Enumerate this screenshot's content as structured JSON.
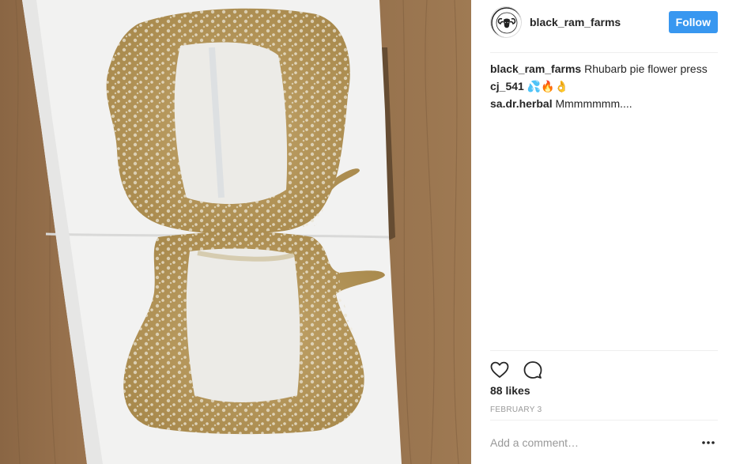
{
  "post": {
    "image_alt": "Rhubarb pie flower press on parchment paper",
    "author": {
      "username": "black_ram_farms",
      "avatar_icon": "ram-logo-icon",
      "avatar_text": "BLACK RAM FARMS"
    },
    "follow_label": "Follow",
    "comments": [
      {
        "author": "black_ram_farms",
        "text": "Rhubarb pie flower press"
      },
      {
        "author": "cj_541",
        "text": "💦🔥👌"
      },
      {
        "author": "sa.dr.herbal",
        "text": "Mmmmmmm...."
      }
    ],
    "actions": [
      {
        "name": "like",
        "icon": "heart-icon"
      },
      {
        "name": "comment",
        "icon": "speech-bubble-icon"
      }
    ],
    "likes_text": "88 likes",
    "date_text": "FEBRUARY 3",
    "comment_placeholder": "Add a comment…",
    "more_icon": "ellipsis-icon"
  },
  "colors": {
    "follow_button": "#3897f0",
    "text_primary": "#262626",
    "text_secondary": "#999999",
    "divider": "#efefef",
    "wood": "#9b7652",
    "paper": "#f3f3f2",
    "resin": "#b89a5c"
  }
}
